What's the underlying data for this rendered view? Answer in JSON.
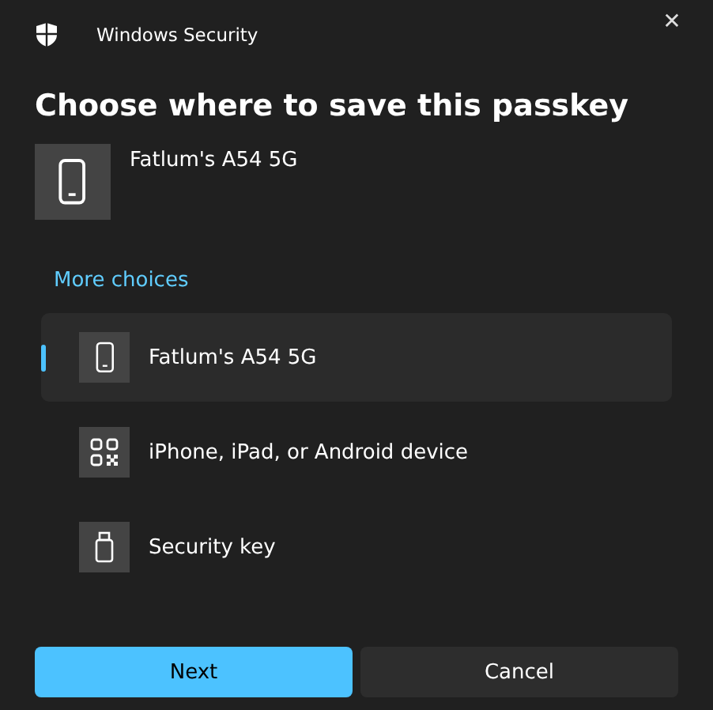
{
  "window": {
    "title": "Windows Security",
    "close": "✕"
  },
  "heading": "Choose where to save this passkey",
  "device": {
    "name": "Fatlum's A54 5G",
    "kind": "phone"
  },
  "more_choices": "More choices",
  "options": [
    {
      "label": "Fatlum's A54 5G",
      "kind": "phone",
      "selected": true
    },
    {
      "label": "iPhone, iPad, or Android device",
      "kind": "qr",
      "selected": false
    },
    {
      "label": "Security key",
      "kind": "usb",
      "selected": false
    }
  ],
  "buttons": [
    {
      "label": "Next",
      "kind": "primary"
    },
    {
      "label": "Cancel",
      "kind": "secondary"
    }
  ]
}
